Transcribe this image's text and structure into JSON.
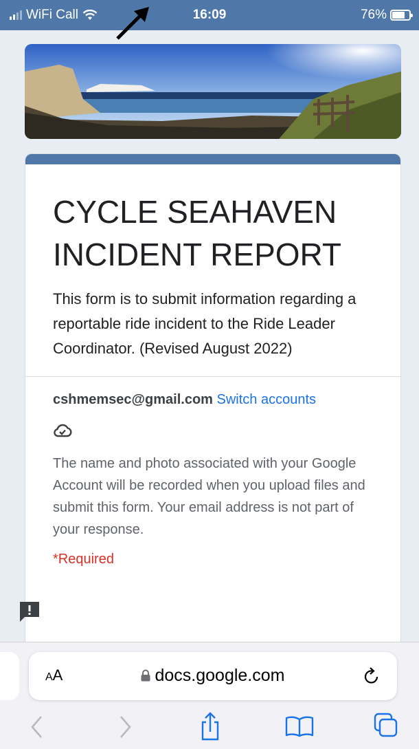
{
  "status_bar": {
    "carrier": "WiFi Call",
    "time": "16:09",
    "battery_percent": "76%",
    "battery_level": 0.76,
    "accent_color": "#4f78a8"
  },
  "banner": {
    "icon": "coastal-cliffs-photo"
  },
  "form": {
    "title": "CYCLE SEAHAVEN INCIDENT REPORT",
    "description": "This form is to submit information regarding a reportable ride incident to the Ride Leader Coordinator. (Revised August 2022)",
    "account_email": "cshmemsec@gmail.com",
    "switch_accounts": "Switch accounts",
    "privacy_notice": "The name and photo associated with your Google Account will be recorded when you upload files and submit this form. Your email address is not part of your response.",
    "required_label": "*Required"
  },
  "browser": {
    "text_size_large": "A",
    "text_size_small": "A",
    "url": "docs.google.com",
    "icons": [
      "back-icon",
      "forward-icon",
      "share-icon",
      "bookmarks-icon",
      "tabs-icon",
      "reload-icon",
      "lock-icon"
    ]
  }
}
